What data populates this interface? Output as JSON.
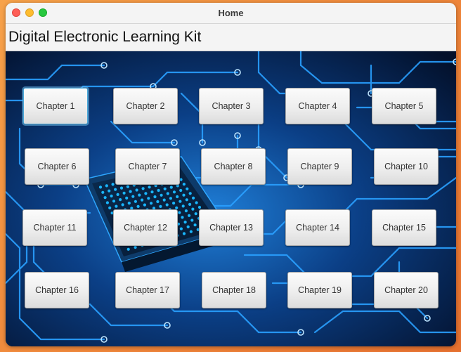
{
  "window": {
    "title": "Home"
  },
  "header": {
    "title": "Digital Electronic Learning Kit"
  },
  "colors": {
    "circuit_bg": "#05142a",
    "circuit_trace": "#2aa0ff",
    "chip_dots": "#19b6ff",
    "focus_ring": "#4aa8d8"
  },
  "chapters": [
    {
      "label": "Chapter 1"
    },
    {
      "label": "Chapter 2"
    },
    {
      "label": "Chapter 3"
    },
    {
      "label": "Chapter 4"
    },
    {
      "label": "Chapter 5"
    },
    {
      "label": "Chapter 6"
    },
    {
      "label": "Chapter 7"
    },
    {
      "label": "Chapter 8"
    },
    {
      "label": "Chapter 9"
    },
    {
      "label": "Chapter 10"
    },
    {
      "label": "Chapter 11"
    },
    {
      "label": "Chapter 12"
    },
    {
      "label": "Chapter 13"
    },
    {
      "label": "Chapter 14"
    },
    {
      "label": "Chapter 15"
    },
    {
      "label": "Chapter 16"
    },
    {
      "label": "Chapter 17"
    },
    {
      "label": "Chapter 18"
    },
    {
      "label": "Chapter 19"
    },
    {
      "label": "Chapter 20"
    }
  ]
}
